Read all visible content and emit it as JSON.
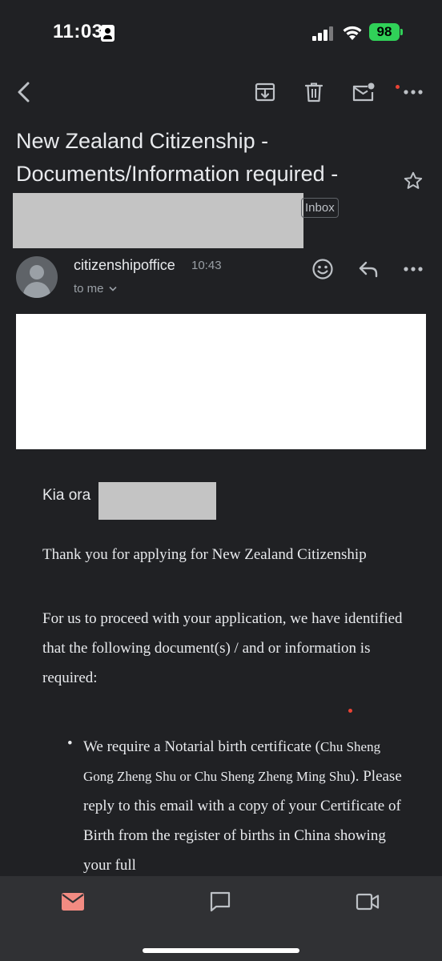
{
  "status_bar": {
    "time": "11:03",
    "battery": "98"
  },
  "email": {
    "subject": "New Zealand Citizenship - Documents/Information required -",
    "label": "Inbox",
    "sender": "citizenshipoffice",
    "time": "10:43",
    "recipient": "to me",
    "greeting": "Kia ora",
    "paragraph_1": "Thank you for applying for New Zealand Citizenship",
    "paragraph_2": "For us to proceed with your application, we have identified that the following document(s) / and or information is required:",
    "bullet_1_part1": "We require a Notarial birth certificate (",
    "bullet_1_part2": "Chu Sheng Gong Zheng Shu or Chu Sheng Zheng Ming Shu",
    "bullet_1_part3": "). Please reply to this email with a copy of your Certificate of Birth from the register of births in China showing your full"
  },
  "icons": {
    "back": "back-arrow-icon",
    "archive": "archive-icon",
    "delete": "trash-icon",
    "mark_unread": "mark-unread-icon",
    "more": "more-horizontal-icon",
    "star": "star-icon",
    "emoji": "emoji-reaction-icon",
    "reply": "reply-icon",
    "mail_tab": "mail-icon",
    "chat_tab": "chat-icon",
    "meet_tab": "video-icon"
  },
  "colors": {
    "background": "#202124",
    "nav_background": "#303134",
    "accent_mail": "#f28b82",
    "battery": "#30d158",
    "notification_dot": "#ea4335"
  }
}
